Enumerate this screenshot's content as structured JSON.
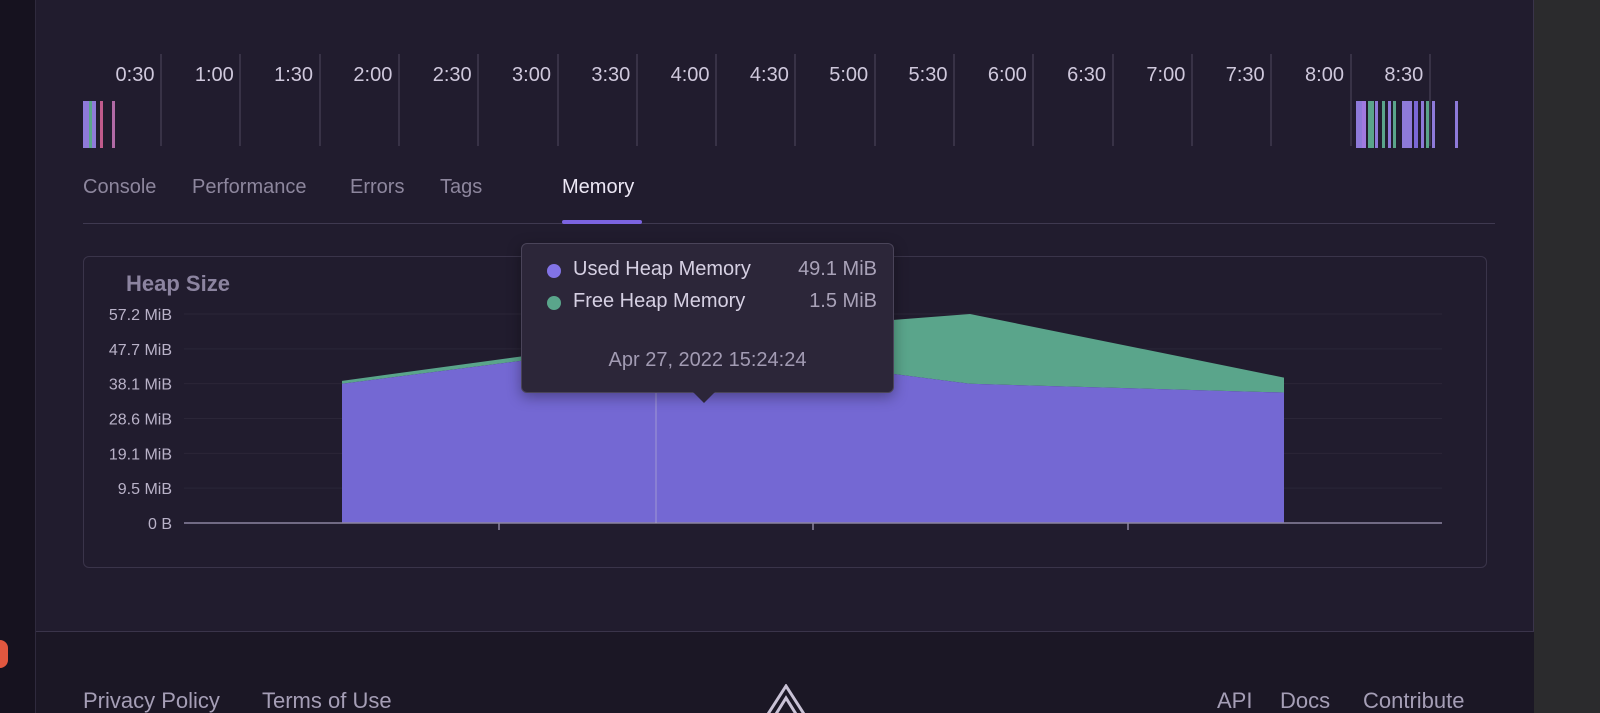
{
  "timeline": {
    "ticks": [
      "0:30",
      "1:00",
      "1:30",
      "2:00",
      "2:30",
      "3:00",
      "3:30",
      "4:00",
      "4:30",
      "5:00",
      "5:30",
      "6:00",
      "6:30",
      "7:00",
      "7:30",
      "8:00",
      "8:30"
    ]
  },
  "tabs": [
    {
      "label": "Console",
      "active": false
    },
    {
      "label": "Performance",
      "active": false
    },
    {
      "label": "Errors",
      "active": false
    },
    {
      "label": "Tags",
      "active": false
    },
    {
      "label": "Memory",
      "active": true
    }
  ],
  "chart": {
    "title": "Heap Size"
  },
  "tooltip": {
    "used_label": "Used Heap Memory",
    "used_value": "49.1 MiB",
    "free_label": "Free Heap Memory",
    "free_value": "1.5 MiB",
    "date": "Apr 27, 2022 15:24:24"
  },
  "footer": {
    "privacy": "Privacy Policy",
    "terms": "Terms of Use",
    "api": "API",
    "docs": "Docs",
    "contribute": "Contribute"
  },
  "colors": {
    "used": "#7468d3",
    "free": "#5aa58b",
    "accent": "#7b63e0"
  },
  "chart_data": {
    "type": "area",
    "title": "Heap Size",
    "xlabel": "",
    "ylabel": "",
    "y_tick_labels": [
      "0 B",
      "9.5 MiB",
      "19.1 MiB",
      "28.6 MiB",
      "38.1 MiB",
      "47.7 MiB",
      "57.2 MiB"
    ],
    "ylim": [
      0,
      57.2
    ],
    "stacked": true,
    "x": [
      0,
      1,
      2,
      3
    ],
    "series": [
      {
        "name": "Used Heap Memory",
        "color": "#7468d3",
        "values": [
          38.1,
          49.1,
          38.1,
          35.7
        ]
      },
      {
        "name": "Free Heap Memory",
        "color": "#5aa58b",
        "values": [
          0.8,
          1.5,
          19.1,
          4.1
        ]
      }
    ],
    "grid": true,
    "legend": "tooltip"
  }
}
